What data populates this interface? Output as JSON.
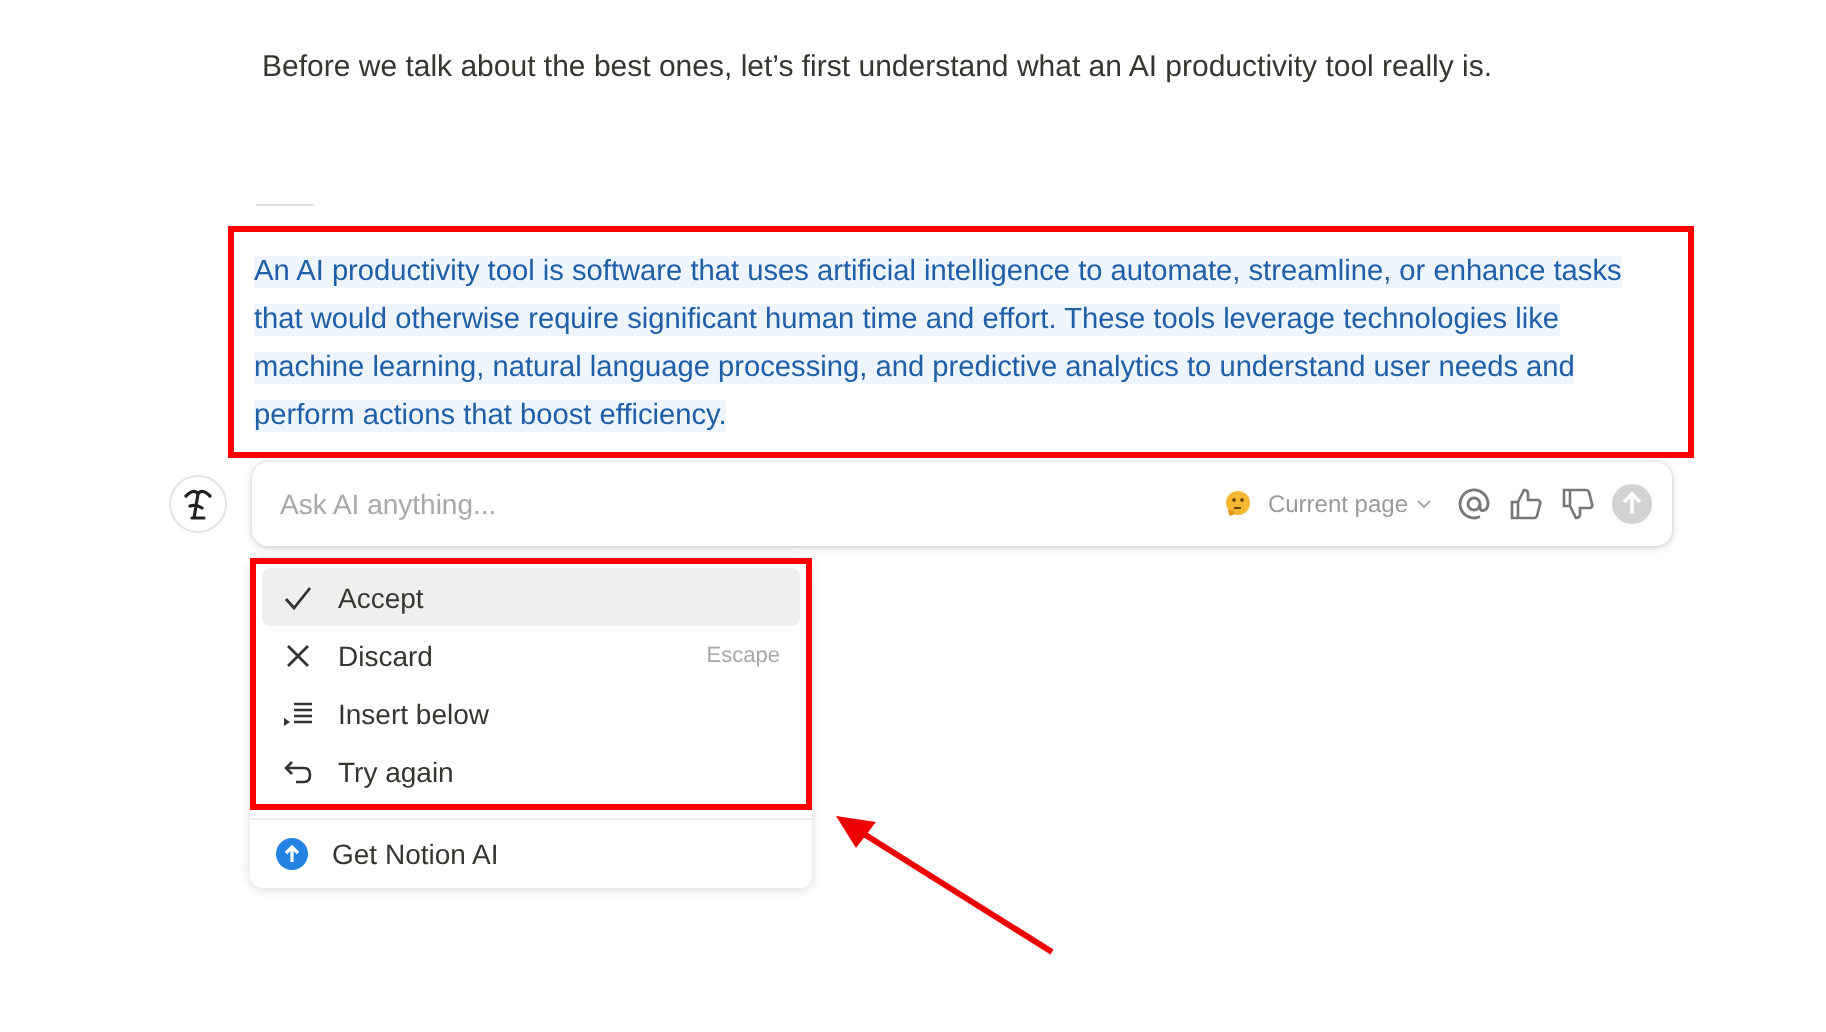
{
  "intro": "Before we talk about the best ones, let’s first understand what an AI productivity tool really is.",
  "ai_response": "An AI productivity tool is software that uses artificial intelligence to automate, streamline, or enhance tasks that would otherwise require significant human time and effort. These tools leverage technologies like machine learning, natural language processing, and predictive analytics to understand user needs and perform actions that boost efficiency.",
  "prompt": {
    "placeholder": "Ask AI anything...",
    "scope": "Current page"
  },
  "menu": [
    {
      "kind": "accept",
      "label": "Accept",
      "selected": true
    },
    {
      "kind": "discard",
      "label": "Discard",
      "shortcut": "Escape",
      "selected": false
    },
    {
      "kind": "insert",
      "label": "Insert below",
      "selected": false
    },
    {
      "kind": "retry",
      "label": "Try again",
      "selected": false
    }
  ],
  "upgrade": {
    "label": "Get Notion AI"
  }
}
